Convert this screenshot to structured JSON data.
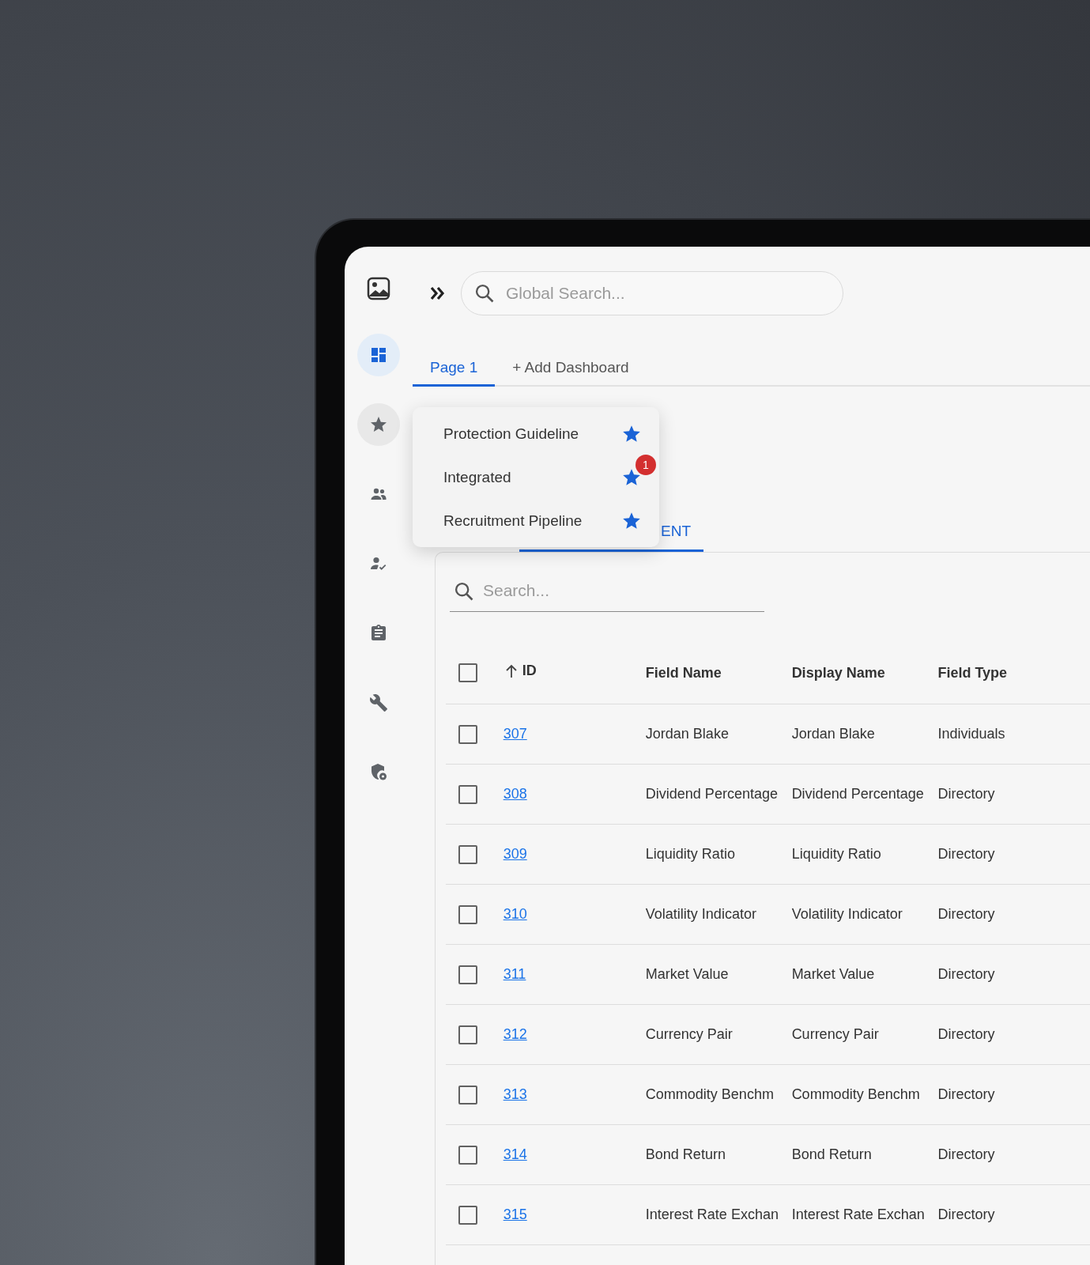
{
  "sidebar": {
    "items": [
      {
        "selected": true,
        "expanded": false
      },
      {
        "selected": false,
        "expanded": true
      },
      {
        "selected": false,
        "expanded": false
      },
      {
        "selected": false,
        "expanded": false
      },
      {
        "selected": false,
        "expanded": false
      },
      {
        "selected": false,
        "expanded": false
      },
      {
        "selected": false,
        "expanded": false
      }
    ]
  },
  "global_search": {
    "placeholder": "Global Search..."
  },
  "tabs": [
    {
      "label": "Page 1",
      "selected": true
    },
    {
      "label": "+ Add Dashboard",
      "selected": false
    }
  ],
  "favorites_menu": {
    "items": [
      {
        "label": "Protection Guideline",
        "starred": true
      },
      {
        "label": "Integrated",
        "starred": true,
        "badge": "1"
      },
      {
        "label": "Recruitment Pipeline",
        "starred": true
      }
    ]
  },
  "sub_tabs": [
    {
      "label": "ENT",
      "selected": true
    }
  ],
  "table": {
    "search": {
      "placeholder": "Search..."
    },
    "select_all": {
      "checked": false
    },
    "columns": [
      {
        "label": "ID",
        "sorted_ascending": true
      },
      {
        "label": "Field Name"
      },
      {
        "label": "Display Name"
      },
      {
        "label": "Field Type"
      }
    ],
    "rows": [
      {
        "checked": false,
        "id": "307",
        "field_name": "Jordan Blake",
        "display_name": "Jordan Blake",
        "field_type": "Individuals"
      },
      {
        "checked": false,
        "id": "308",
        "field_name": "Dividend Percentage",
        "display_name": "Dividend Percentage",
        "field_type": "Directory"
      },
      {
        "checked": false,
        "id": "309",
        "field_name": "Liquidity Ratio",
        "display_name": "Liquidity Ratio",
        "field_type": "Directory"
      },
      {
        "checked": false,
        "id": "310",
        "field_name": "Volatility Indicator",
        "display_name": "Volatility Indicator",
        "field_type": "Directory"
      },
      {
        "checked": false,
        "id": "311",
        "field_name": "Market Value",
        "display_name": "Market Value",
        "field_type": "Directory"
      },
      {
        "checked": false,
        "id": "312",
        "field_name": "Currency Pair",
        "display_name": "Currency Pair",
        "field_type": "Directory"
      },
      {
        "checked": false,
        "id": "313",
        "field_name": "Commodity Benchm",
        "display_name": "Commodity Benchm",
        "field_type": "Directory"
      },
      {
        "checked": false,
        "id": "314",
        "field_name": "Bond Return",
        "display_name": "Bond Return",
        "field_type": "Directory"
      },
      {
        "checked": false,
        "id": "315",
        "field_name": "Interest Rate Exchan",
        "display_name": "Interest Rate Exchan",
        "field_type": "Directory"
      }
    ]
  }
}
